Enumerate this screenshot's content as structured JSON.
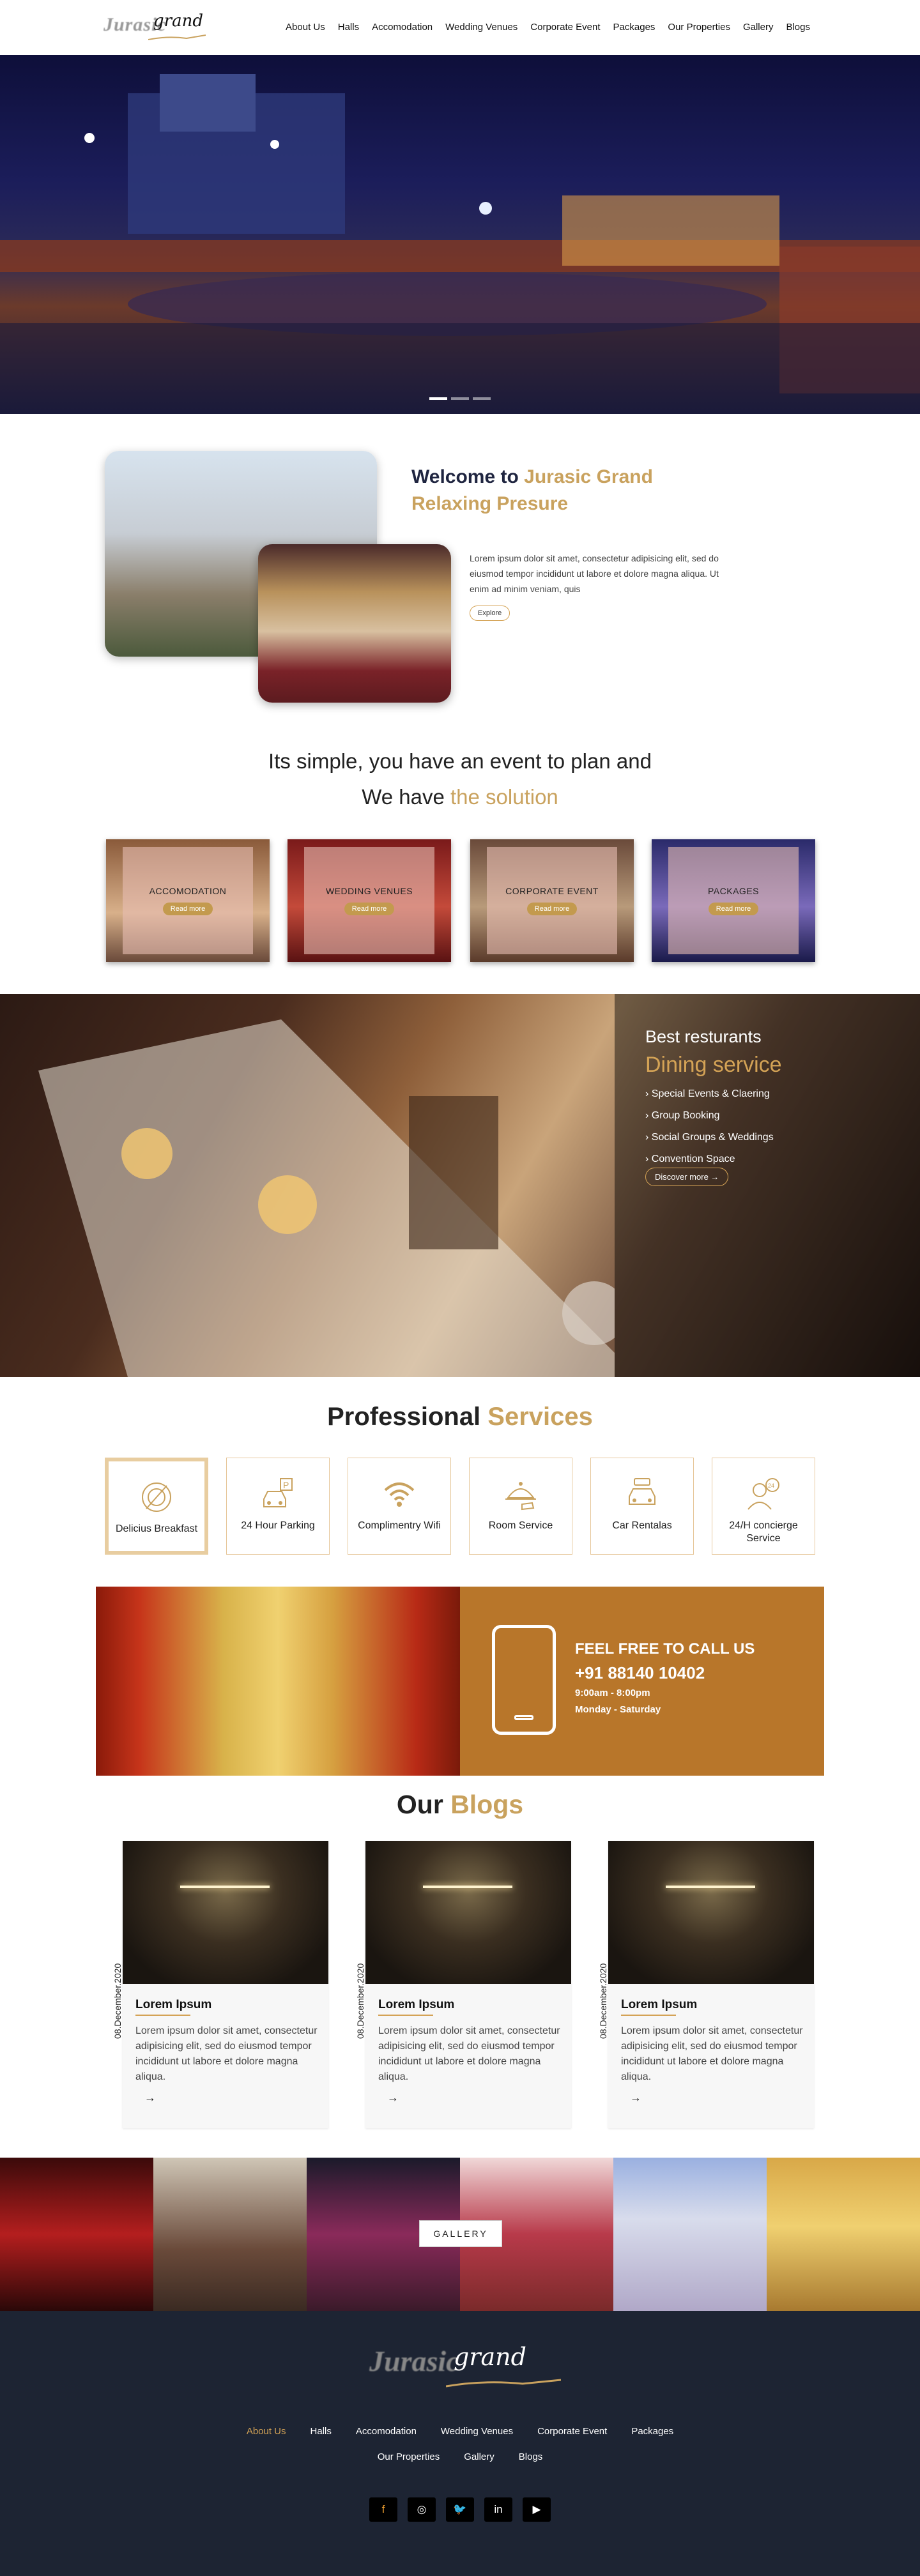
{
  "header": {
    "logo_word1": "Jurasic",
    "logo_word2": "grand",
    "nav": [
      "About Us",
      "Halls",
      "Accomodation",
      "Wedding Venues",
      "Corporate Event",
      "Packages",
      "Our Properties",
      "Gallery",
      "Blogs"
    ]
  },
  "hero": {
    "slides": 3,
    "active_slide": 1
  },
  "welcome": {
    "title_prefix": "Welcome to ",
    "title_highlight": "Jurasic Grand Relaxing Presure",
    "text": "Lorem ipsum dolor sit amet, consectetur adipisicing elit, sed do eiusmod tempor incididunt ut labore et dolore magna aliqua. Ut enim ad minim veniam, quis",
    "button": "Explore"
  },
  "solution": {
    "line1": "Its simple, you have an event to plan and",
    "line2_prefix": "We have ",
    "line2_highlight": "the solution",
    "cards": [
      {
        "title": "ACCOMODATION",
        "button": "Read more"
      },
      {
        "title": "WEDDING VENUES",
        "button": "Read more"
      },
      {
        "title": "CORPORATE EVENT",
        "button": "Read more"
      },
      {
        "title": "PACKAGES",
        "button": "Read more"
      }
    ]
  },
  "dining": {
    "heading": "Best resturants",
    "subheading": "Dining service",
    "items": [
      "Special Events & Claering",
      "Group Booking",
      "Social Groups & Weddings",
      "Convention Space"
    ],
    "button": "Discover more"
  },
  "services": {
    "title_prefix": "Professional ",
    "title_highlight": "Services",
    "items": [
      {
        "icon": "plate-icon",
        "label": "Delicius Breakfast"
      },
      {
        "icon": "parking-car-icon",
        "label": "24 Hour Parking"
      },
      {
        "icon": "wifi-icon",
        "label": "Complimentry Wifi"
      },
      {
        "icon": "room-service-icon",
        "label": "Room Service"
      },
      {
        "icon": "car-rental-icon",
        "label": "Car Rentalas"
      },
      {
        "icon": "concierge-icon",
        "label": "24/H concierge Service"
      }
    ]
  },
  "call": {
    "line1": "FEEL FREE TO CALL US",
    "phone": "+91 88140 10402",
    "hours": "9:00am - 8:00pm",
    "days": "Monday - Saturday"
  },
  "blogs": {
    "title_prefix": "Our ",
    "title_highlight": "Blogs",
    "posts": [
      {
        "date": "08.December.2020",
        "title": "Lorem Ipsum",
        "text": "Lorem ipsum dolor sit amet, consectetur adipisicing elit, sed do eiusmod tempor incididunt ut labore et dolore magna aliqua.",
        "arrow": "→"
      },
      {
        "date": "08.December.2020",
        "title": "Lorem Ipsum",
        "text": "Lorem ipsum dolor sit amet, consectetur adipisicing elit, sed do eiusmod tempor incididunt ut labore et dolore magna aliqua.",
        "arrow": "→"
      },
      {
        "date": "08.December.2020",
        "title": "Lorem Ipsum",
        "text": "Lorem ipsum dolor sit amet, consectetur adipisicing elit, sed do eiusmod tempor incididunt ut labore et dolore magna aliqua.",
        "arrow": "→"
      }
    ]
  },
  "gallery": {
    "button": "GALLERY"
  },
  "footer": {
    "logo_word1": "Jurasic",
    "logo_word2": "grand",
    "links_row1": [
      "About Us",
      "Halls",
      "Accomodation",
      "Wedding Venues",
      "Corporate Event",
      "Packages"
    ],
    "links_row2": [
      "Our Properties",
      "Gallery",
      "Blogs"
    ],
    "social": [
      {
        "icon": "facebook-icon",
        "glyph": "f"
      },
      {
        "icon": "instagram-icon",
        "glyph": "◎"
      },
      {
        "icon": "twitter-icon",
        "glyph": "🐦"
      },
      {
        "icon": "linkedin-icon",
        "glyph": "in"
      },
      {
        "icon": "youtube-icon",
        "glyph": "▶"
      }
    ]
  },
  "colors": {
    "accent": "#c9a25e",
    "footer_bg": "#1d2433",
    "call_bg": "#b8762a"
  }
}
